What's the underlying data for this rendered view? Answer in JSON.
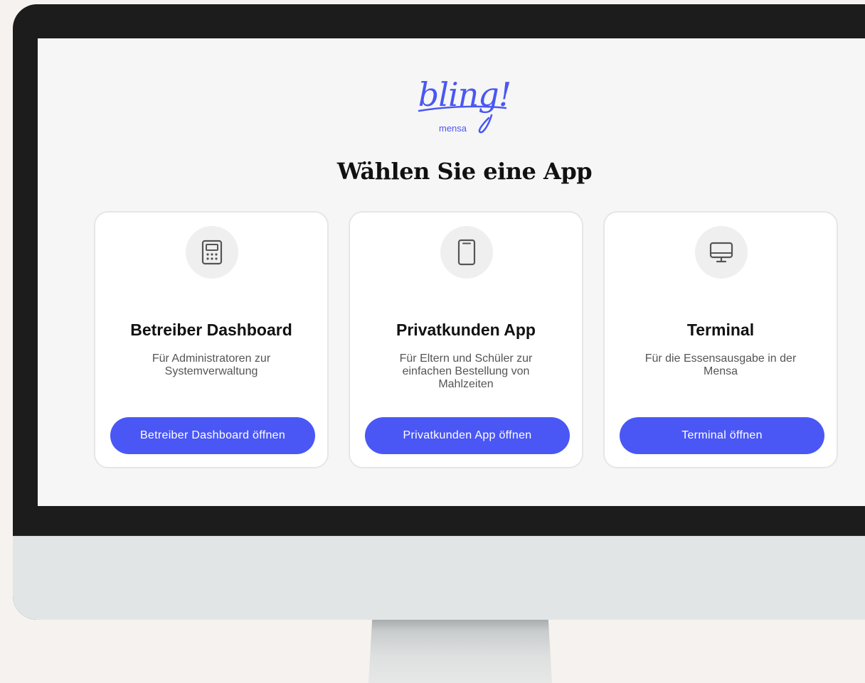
{
  "brand": {
    "logo_text": "bling!",
    "logo_sub": "mensa",
    "accent_color": "#4a57f5"
  },
  "page": {
    "title": "Wählen Sie eine App"
  },
  "cards": [
    {
      "icon": "calculator-icon",
      "title": "Betreiber Dashboard",
      "description": "Für Administratoren zur Systemverwaltung",
      "button_label": "Betreiber Dashboard öffnen"
    },
    {
      "icon": "smartphone-icon",
      "title": "Privatkunden App",
      "description": "Für Eltern und Schüler zur einfachen Bestellung von Mahlzeiten",
      "button_label": "Privatkunden App öffnen"
    },
    {
      "icon": "monitor-icon",
      "title": "Terminal",
      "description": "Für die Essensausgabe in der Mensa",
      "button_label": "Terminal öffnen"
    }
  ]
}
